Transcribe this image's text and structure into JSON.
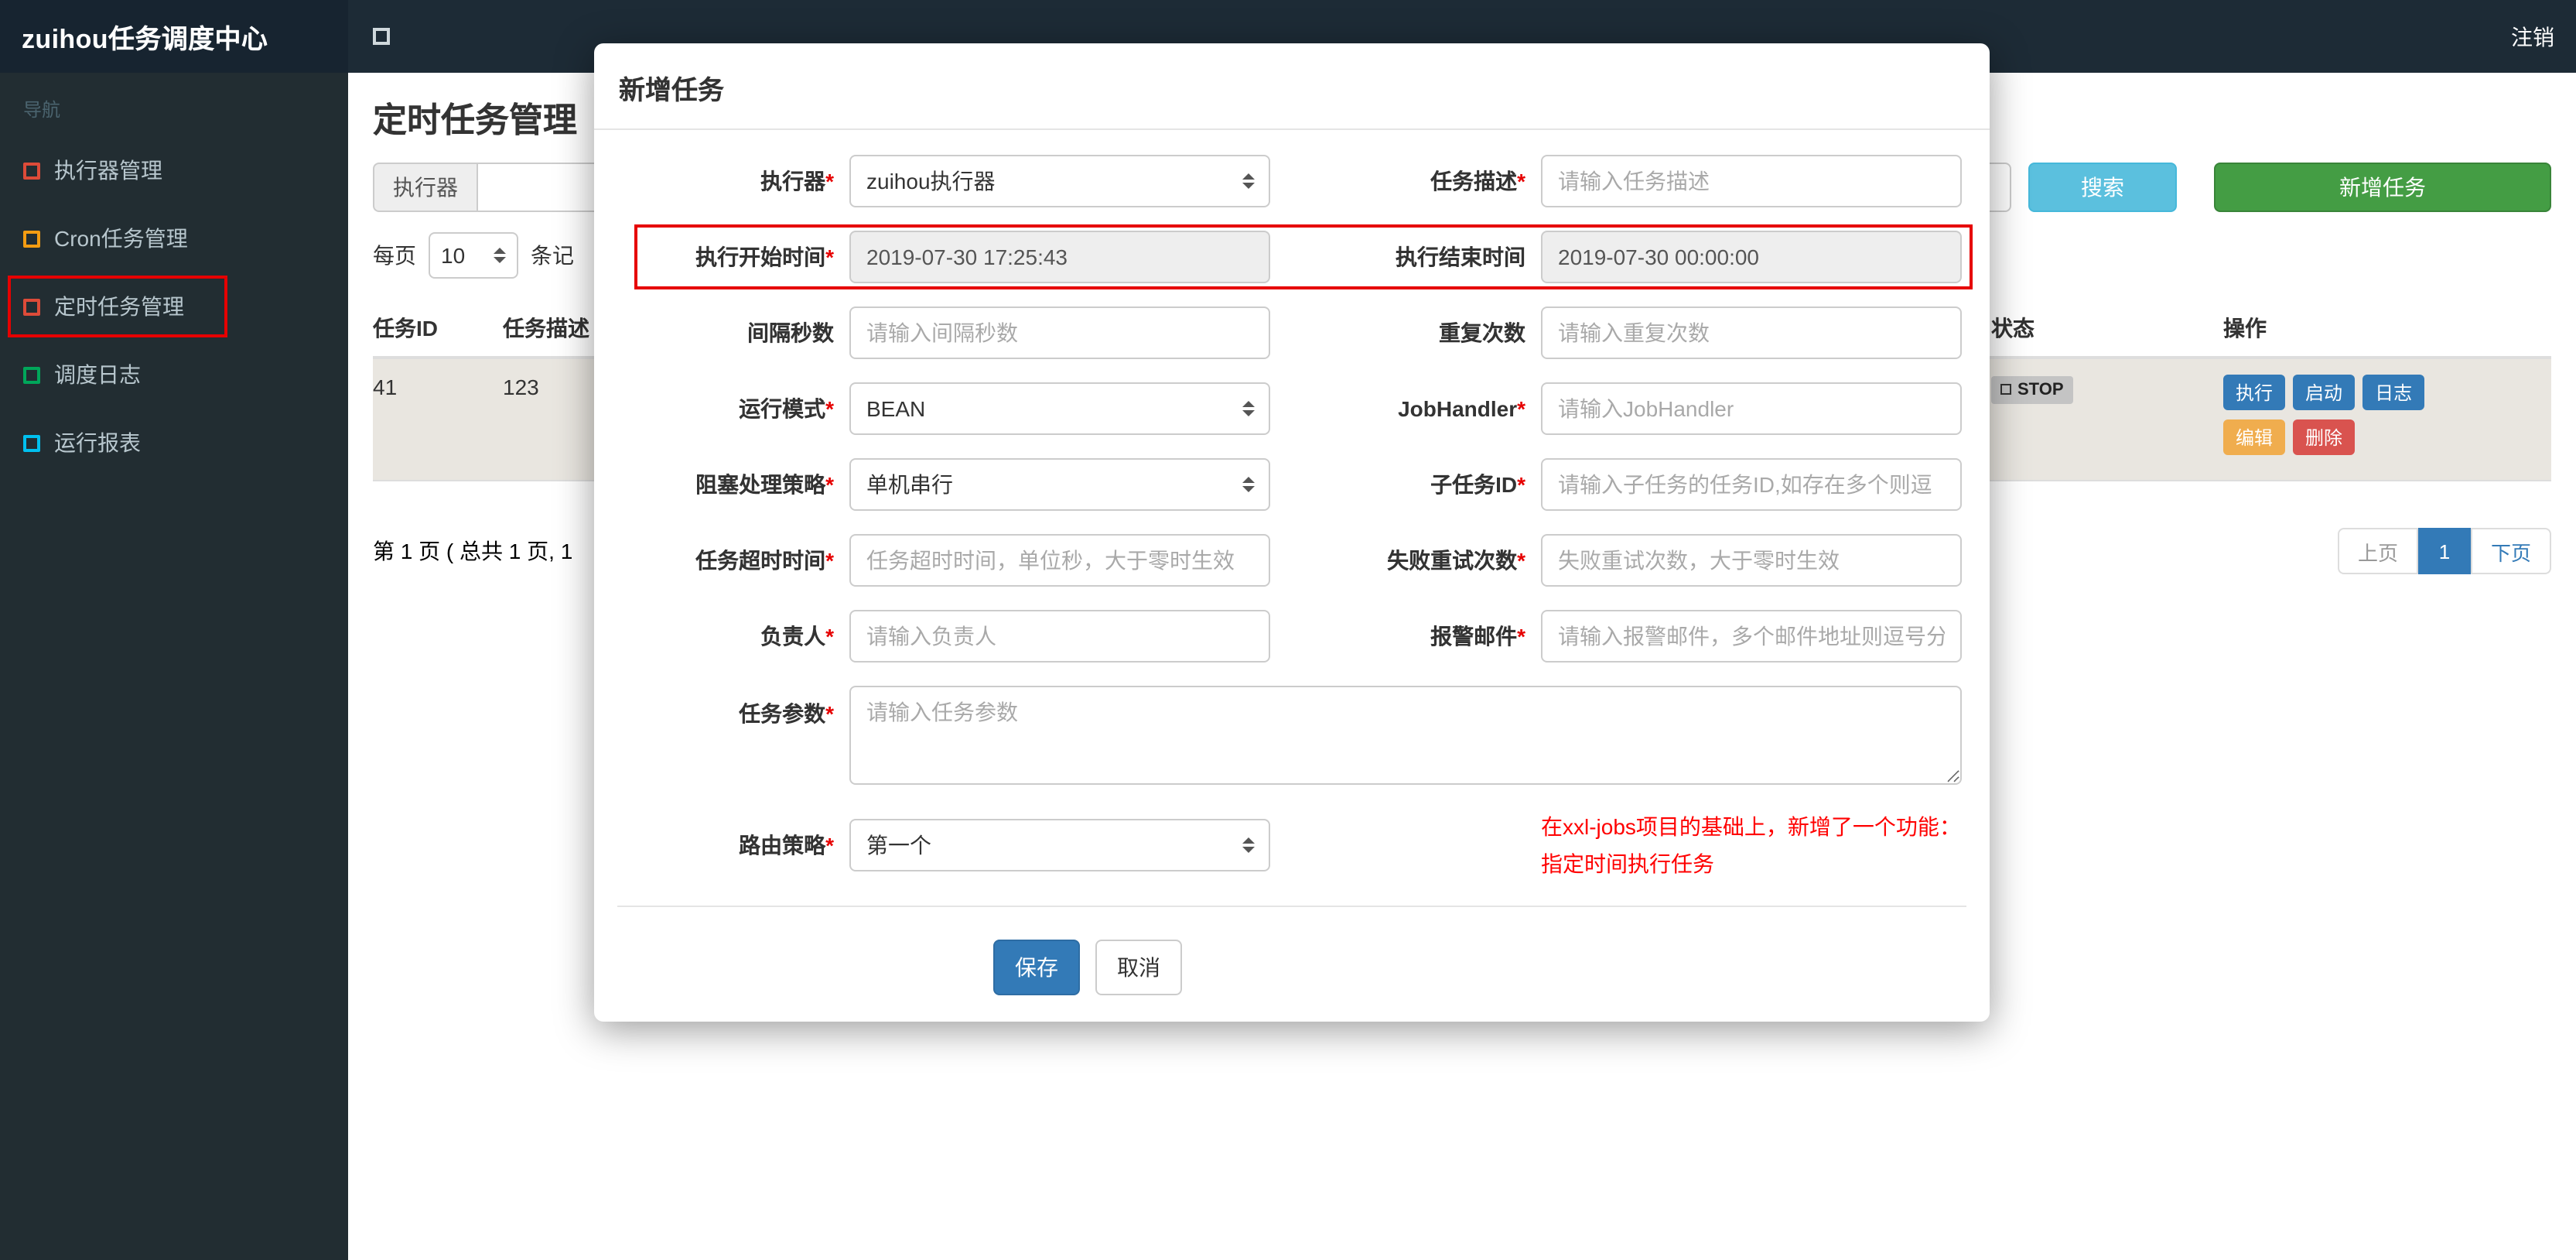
{
  "topbar": {
    "brand": "zuihou任务调度中心",
    "logout": "注销"
  },
  "sidebar": {
    "nav_label": "导航",
    "items": [
      {
        "label": "执行器管理",
        "icon": "red-square-icon"
      },
      {
        "label": "Cron任务管理",
        "icon": "yellow-square-icon"
      },
      {
        "label": "定时任务管理",
        "icon": "red-square-icon",
        "annotated": true
      },
      {
        "label": "调度日志",
        "icon": "green-square-icon"
      },
      {
        "label": "运行报表",
        "icon": "aqua-square-icon"
      }
    ]
  },
  "page": {
    "title": "定时任务管理",
    "toolbar": {
      "executor_label": "执行器",
      "search_button": "搜索",
      "add_button": "新增任务"
    },
    "per_page": {
      "label": "每页",
      "value": "10",
      "suffix": "条记"
    },
    "table": {
      "headers": [
        "任务ID",
        "任务描述",
        "状态",
        "操作"
      ],
      "row": {
        "id": "41",
        "desc": "123",
        "status": "STOP",
        "actions": {
          "execute": "执行",
          "start": "启动",
          "log": "日志",
          "edit": "编辑",
          "delete": "删除"
        }
      }
    },
    "pagination": {
      "summary": "第 1 页 ( 总共 1 页, 1",
      "prev": "上页",
      "page": "1",
      "next": "下页"
    }
  },
  "modal": {
    "title": "新增任务",
    "executor": {
      "label": "执行器",
      "value": "zuihou执行器"
    },
    "job_desc": {
      "label": "任务描述",
      "placeholder": "请输入任务描述"
    },
    "start_time": {
      "label": "执行开始时间",
      "value": "2019-07-30 17:25:43"
    },
    "end_time": {
      "label": "执行结束时间",
      "value": "2019-07-30 00:00:00"
    },
    "interval": {
      "label": "间隔秒数",
      "placeholder": "请输入间隔秒数"
    },
    "repeat": {
      "label": "重复次数",
      "placeholder": "请输入重复次数"
    },
    "run_mode": {
      "label": "运行模式",
      "value": "BEAN"
    },
    "job_handler": {
      "label": "JobHandler",
      "placeholder": "请输入JobHandler"
    },
    "block_strategy": {
      "label": "阻塞处理策略",
      "value": "单机串行"
    },
    "child_job": {
      "label": "子任务ID",
      "placeholder": "请输入子任务的任务ID,如存在多个则逗"
    },
    "timeout": {
      "label": "任务超时时间",
      "placeholder": "任务超时时间，单位秒，大于零时生效"
    },
    "retry": {
      "label": "失败重试次数",
      "placeholder": "失败重试次数，大于零时生效"
    },
    "owner": {
      "label": "负责人",
      "placeholder": "请输入负责人"
    },
    "alarm_email": {
      "label": "报警邮件",
      "placeholder": "请输入报警邮件，多个邮件地址则逗号分"
    },
    "job_param": {
      "label": "任务参数",
      "placeholder": "请输入任务参数"
    },
    "route_strategy": {
      "label": "路由策略",
      "value": "第一个"
    },
    "note_line1": "在xxl-jobs项目的基础上，新增了一个功能：",
    "note_line2": "指定时间执行任务",
    "save": "保存",
    "cancel": "取消"
  },
  "icons": {
    "sidebar-toggle-icon": "□",
    "square-icon": "□",
    "select-arrows-icon": "⇕"
  },
  "colors": {
    "topbar_bg": "#1d2b36",
    "sidebar_bg": "#222d32",
    "accent_blue": "#337ab7",
    "info_teal": "#5bc0de",
    "success_green": "#449d44",
    "warning_orange": "#f0ad4e",
    "danger_red": "#d9534f",
    "annotation_red": "#e60000",
    "status_badge_bg": "#c4c4c4"
  }
}
